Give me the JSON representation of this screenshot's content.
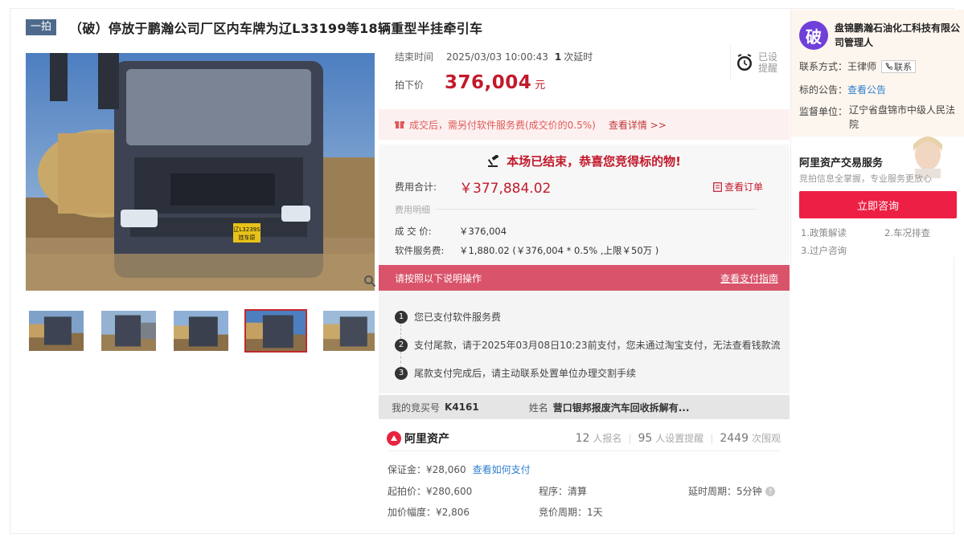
{
  "title": {
    "tag": "一拍",
    "text": "（破）停放于鹏瀚公司厂区内车牌为辽L33199等18辆重型半挂牵引车"
  },
  "gallery": {
    "plate_line1": "辽L3239S",
    "plate_line2": "挂车原",
    "thumb_count": 5,
    "active_thumb": 3
  },
  "auction": {
    "end_label": "结束时间",
    "end_time": "2025/03/03 10:00:43",
    "delay_count": "1",
    "delay_label": "次延时",
    "remind_line1": "已设",
    "remind_line2": "提醒",
    "price_label": "拍下价",
    "price": "376,004",
    "price_unit": "元",
    "notice": "成交后，需另付软件服务费(成交价的0.5%)",
    "notice_link": "查看详情 >>",
    "result_title": "本场已结束，恭喜您竞得标的物!",
    "total_label": "费用合计:",
    "total_value": "￥377,884.02",
    "order_link": "查看订单",
    "detail_label": "费用明细",
    "deal_label": "成 交 价:",
    "deal_value": "￥376,004",
    "fee_label": "软件服务费:",
    "fee_value": "￥1,880.02 (￥376,004 * 0.5% ,上限￥50万 )",
    "guide_text": "请按照以下说明操作",
    "guide_link": "查看支付指南",
    "steps": [
      "您已支付软件服务费",
      "支付尾款，请于2025年03月08日10:23前支付，您未通过淘宝支付，无法查看钱款流",
      "尾款支付完成后，请主动联系处置单位办理交割手续"
    ],
    "bid_no_label": "我的竞买号",
    "bid_no": "K4161",
    "name_label": "姓名",
    "name_value": "营口银邦报废汽车回收拆解有..."
  },
  "stats": {
    "logo": "阿里资产",
    "signups": "12",
    "signups_label": "人报名",
    "reminders": "95",
    "reminders_label": "人设置提醒",
    "views": "2449",
    "views_label": "次围观"
  },
  "info": {
    "deposit": "保证金：¥28,060",
    "deposit_link": "查看如何支付",
    "start_price": "起拍价：¥280,600",
    "procedure": "程序：清算",
    "delay_period": "延时周期：5分钟",
    "increment": "加价幅度：¥2,806",
    "bid_period": "竞价周期：1天"
  },
  "sidebar": {
    "avatar_char": "破",
    "org_name": "盘锦鹏瀚石油化工科技有限公司管理人",
    "contact_label": "联系方式：",
    "contact_name": "王律师",
    "contact_btn": "联系",
    "notice_label": "标的公告：",
    "notice_link": "查看公告",
    "supervisor_label": "监督单位：",
    "supervisor_value": "辽宁省盘锦市中级人民法院",
    "svc_title": "阿里资产交易服务",
    "svc_sub": "竞拍信息全掌握，专业服务更放心",
    "svc_btn": "立即咨询",
    "links": [
      "1.政策解读",
      "2.车况排查",
      "3.过户咨询"
    ]
  },
  "colors": {
    "accent_red": "#c21a2c",
    "guide_pink": "#d9536a",
    "consult_red": "#ee1f44",
    "link_blue": "#2f7fd0"
  }
}
